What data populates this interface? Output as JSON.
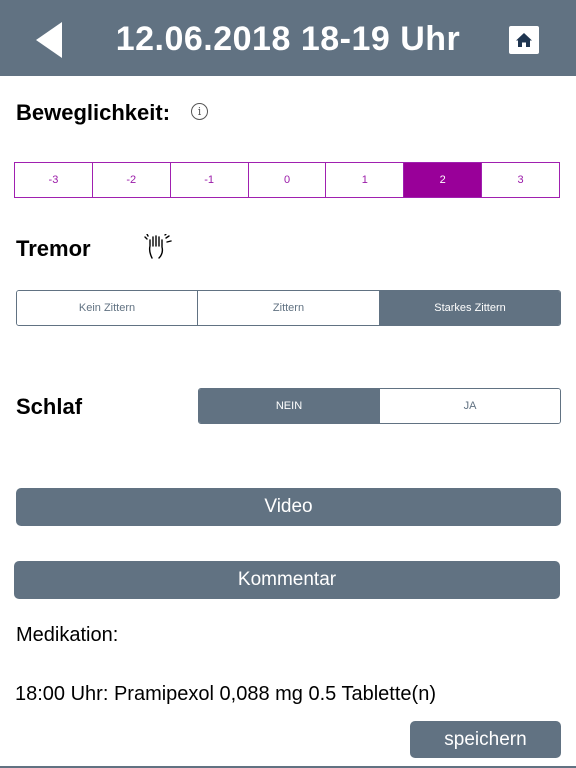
{
  "header": {
    "title": "12.06.2018  18-19 Uhr",
    "bg_color": "#617282"
  },
  "mobility": {
    "label": "Beweglichkeit:",
    "options": [
      "-3",
      "-2",
      "-1",
      "0",
      "1",
      "2",
      "3"
    ],
    "selected": "2",
    "accent_color": "#990099"
  },
  "tremor": {
    "label": "Tremor",
    "options": [
      "Kein Zittern",
      "Zittern",
      "Starkes Zittern"
    ],
    "selected": "Starkes Zittern"
  },
  "sleep": {
    "label": "Schlaf",
    "options": [
      "NEIN",
      "JA"
    ],
    "selected": "NEIN"
  },
  "buttons": {
    "video": "Video",
    "comment": "Kommentar",
    "save": "speichern"
  },
  "medication": {
    "label": "Medikation:",
    "entries": [
      "18:00 Uhr: Pramipexol 0,088 mg 0.5 Tablette(n)"
    ]
  },
  "icons": {
    "back": "back-arrow-icon",
    "home": "home-icon",
    "info": "info-icon",
    "tremor": "shaking-hand-icon"
  }
}
